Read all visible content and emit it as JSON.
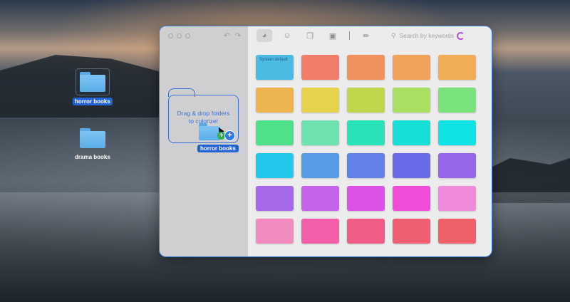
{
  "desktop": {
    "icons": [
      {
        "label": "horror books",
        "selected": true
      },
      {
        "label": "drama books",
        "selected": false
      }
    ]
  },
  "sidebar": {
    "dropzone_line1": "Drag & drop folders",
    "dropzone_line2": "to colorize!",
    "drag_label": "horror books"
  },
  "toolbar": {
    "search_placeholder": "Search by keywords",
    "icons": [
      "palette-icon",
      "emoji-icon",
      "layers-icon",
      "image-icon",
      "eyedropper-icon",
      "search-icon"
    ]
  },
  "swatches": [
    {
      "color": "#4bbbe3",
      "label": "System default"
    },
    {
      "color": "#f07e6a"
    },
    {
      "color": "#f0915e"
    },
    {
      "color": "#f0a25a"
    },
    {
      "color": "#f0ad56"
    },
    {
      "color": "#eeb44f"
    },
    {
      "color": "#e6d24c"
    },
    {
      "color": "#c0d54c"
    },
    {
      "color": "#a9e064"
    },
    {
      "color": "#79e27b"
    },
    {
      "color": "#4fe08a"
    },
    {
      "color": "#6de2ae"
    },
    {
      "color": "#29e2b7"
    },
    {
      "color": "#18dfd6"
    },
    {
      "color": "#10e3e6"
    },
    {
      "color": "#23c7ec"
    },
    {
      "color": "#559be5"
    },
    {
      "color": "#6181e8"
    },
    {
      "color": "#6a6ae8"
    },
    {
      "color": "#9565ea"
    },
    {
      "color": "#a667e8"
    },
    {
      "color": "#c563ea"
    },
    {
      "color": "#dc51e6"
    },
    {
      "color": "#f04cd8"
    },
    {
      "color": "#f08adb"
    },
    {
      "color": "#f08cc0"
    },
    {
      "color": "#f25ea7"
    },
    {
      "color": "#ef5d87"
    },
    {
      "color": "#f05e73"
    },
    {
      "color": "#ef6069"
    }
  ]
}
